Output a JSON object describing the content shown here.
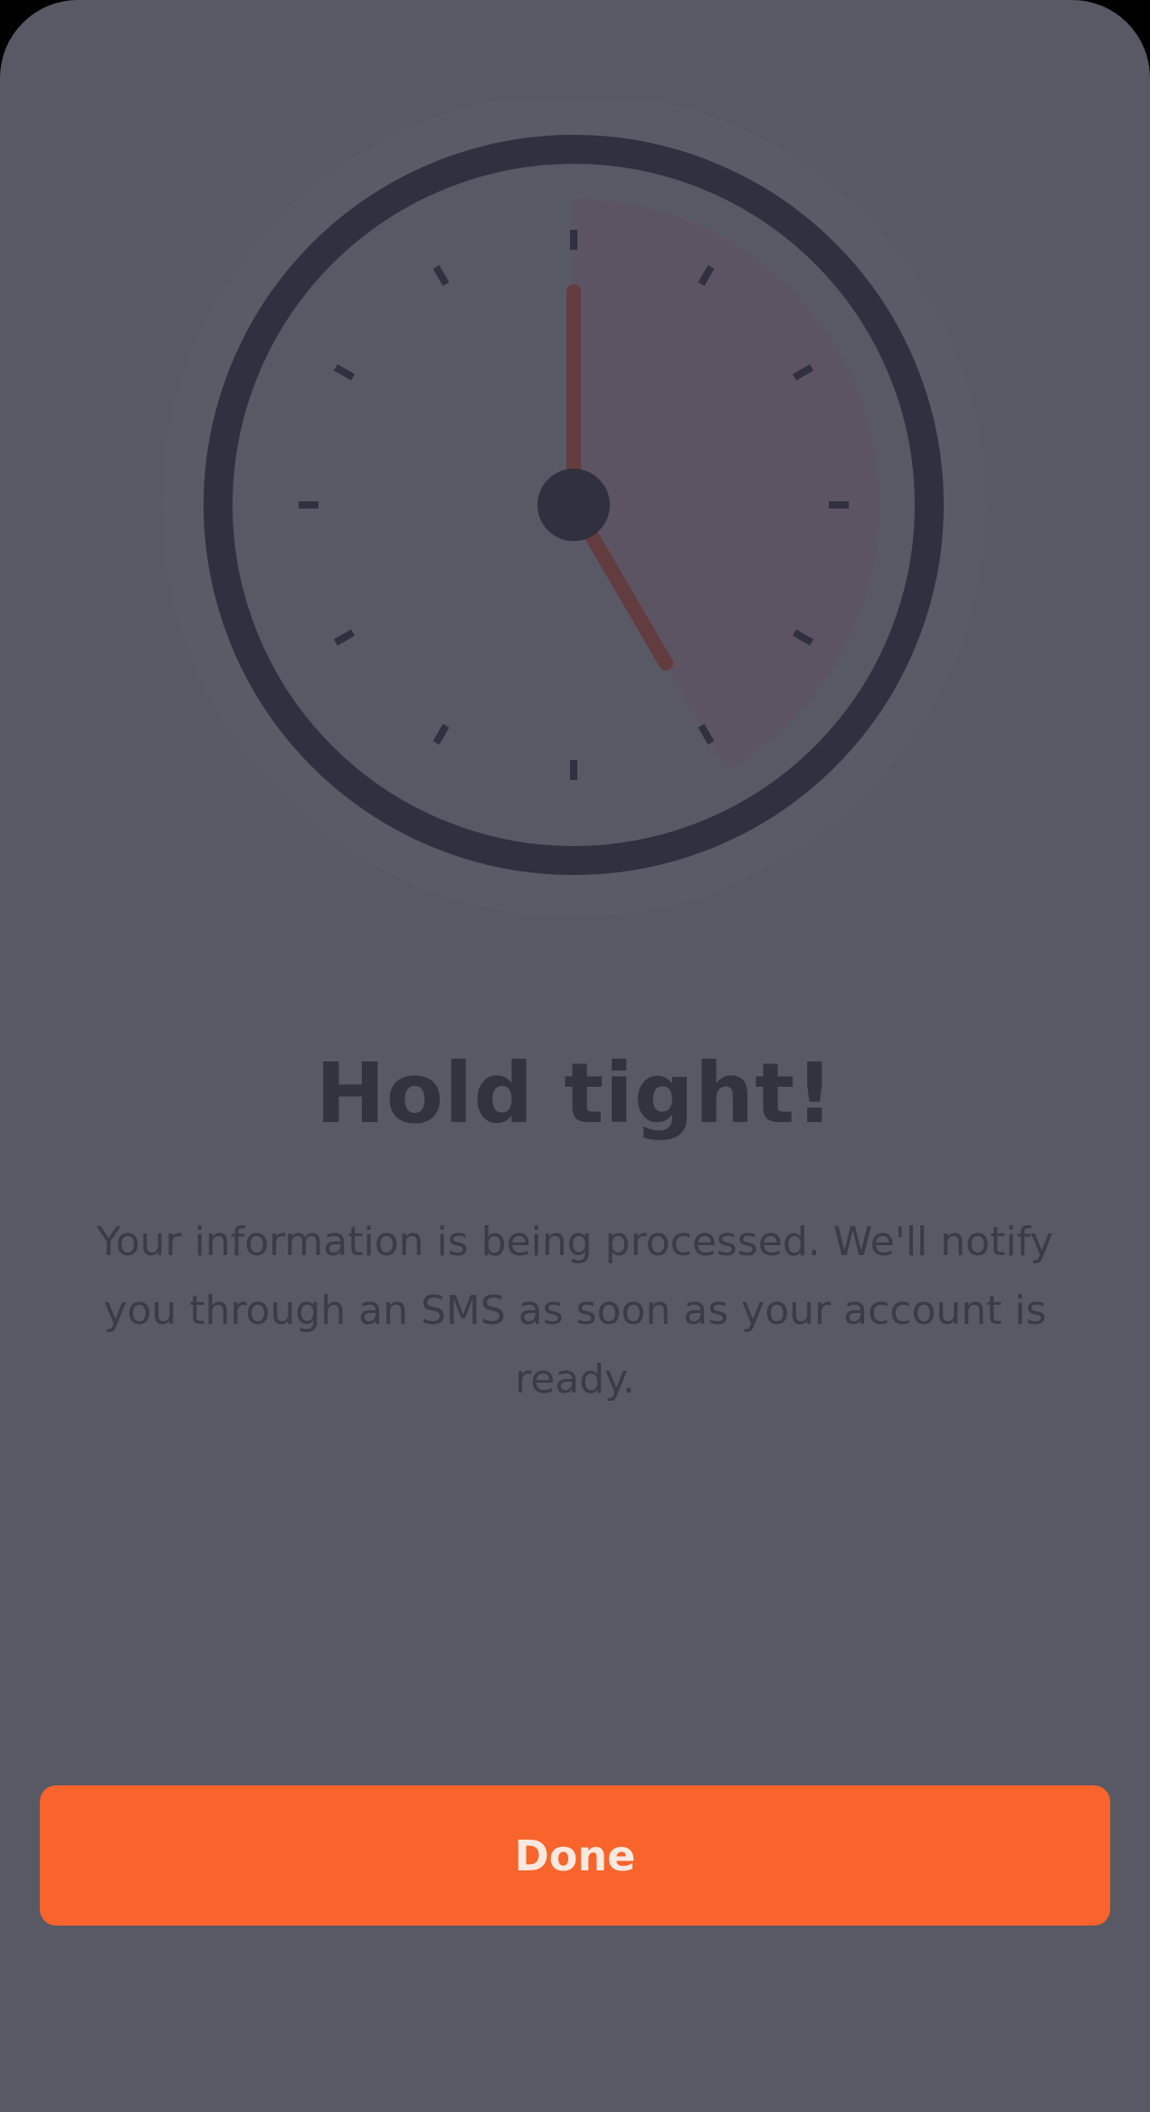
{
  "screen": {
    "illustration_icon": "clock-icon",
    "title": "Hold tight!",
    "message": "Your information is being processed. We'll notify you through an SMS as soon as your account is ready.",
    "done_button_label": "Done"
  },
  "colors": {
    "background": "#595965",
    "clock_ring": "#30303e",
    "clock_hands": "#623c3f",
    "elapsed_wedge": "#5c5462",
    "accent_button": "#f8642b",
    "button_text": "#fbe9e0",
    "title_text": "#33333f",
    "body_text": "#3b3b48"
  }
}
